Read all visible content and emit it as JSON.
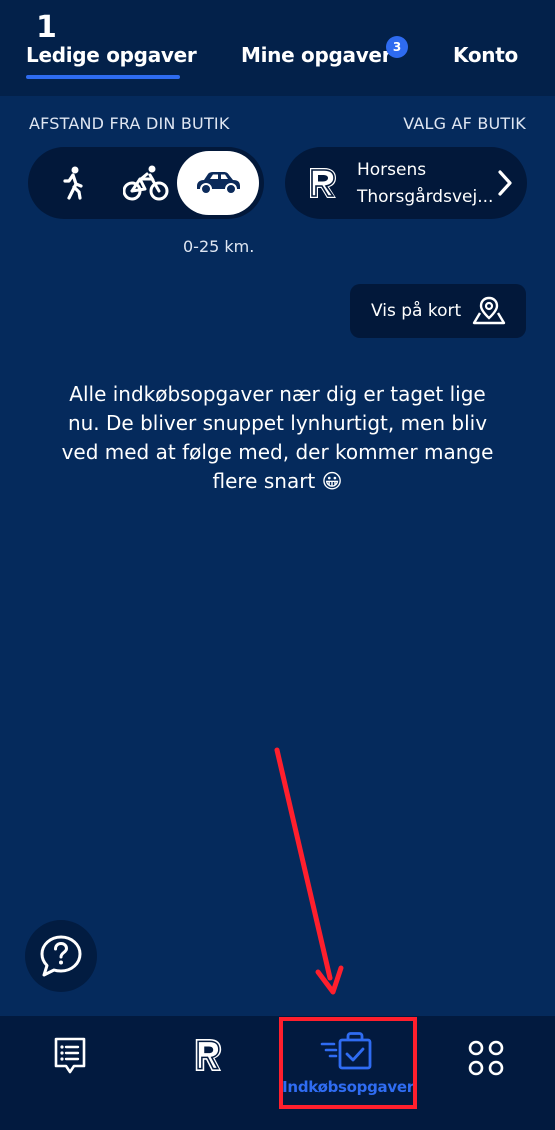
{
  "top_tabs": {
    "available_count": "1",
    "tabs": [
      {
        "label": "Ledige opgaver"
      },
      {
        "label": "Mine opgaver"
      },
      {
        "label": "Konto"
      }
    ],
    "mine_badge": "3"
  },
  "filters": {
    "distance_label": "AFSTAND FRA DIN BUTIK",
    "store_label": "VALG AF BUTIK",
    "modes": [
      "walk-icon",
      "bike-icon",
      "car-icon"
    ],
    "selected_mode": "car",
    "distance_range": "0-25 km."
  },
  "store": {
    "city": "Horsens",
    "street": "Thorsgårdsvej..."
  },
  "map_button": {
    "label": "Vis på kort"
  },
  "empty_message": "Alle indkøbsopgaver nær dig er taget lige nu. De bliver snuppet lynhurtigt, men bliv ved med at følge med, der kommer mange flere snart 😀",
  "bottom_nav": {
    "items": [
      {
        "icon": "list-icon"
      },
      {
        "icon": "brand-r-icon"
      },
      {
        "icon": "shopping-tasks-icon",
        "label": "Indkøbsopgaver",
        "active": true
      },
      {
        "icon": "more-apps-icon"
      }
    ]
  },
  "colors": {
    "background": "#052a5c",
    "accent": "#2e6bf0",
    "annotation": "#ff1f2d"
  }
}
